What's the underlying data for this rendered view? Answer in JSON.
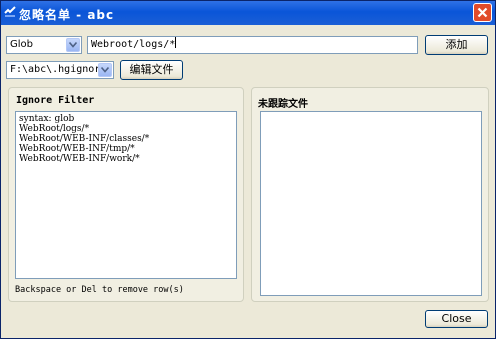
{
  "window": {
    "title": "忽略名单 - abc",
    "icons": {
      "app": "app-icon",
      "close": "close-icon"
    }
  },
  "toolbar": {
    "syntax_select": {
      "value": "Glob"
    },
    "pattern_input": {
      "value": "Webroot/logs/*"
    },
    "add_button": {
      "label": "添加"
    },
    "file_select": {
      "value": "F:\\abc\\.hgignore"
    },
    "edit_file_button": {
      "label": "编辑文件"
    }
  },
  "ignore_filter": {
    "title": "Ignore Filter",
    "rows": [
      "syntax: glob",
      "WebRoot/logs/*",
      "WebRoot/WEB-INF/classes/*",
      "WebRoot/WEB-INF/tmp/*",
      "WebRoot/WEB-INF/work/*"
    ],
    "hint": "Backspace or Del to remove row(s)"
  },
  "untracked": {
    "title": "未跟踪文件",
    "rows": []
  },
  "footer": {
    "close_button": {
      "label": "Close"
    }
  },
  "colors": {
    "titlebar": "#0a55d8",
    "dialog_bg": "#ece9d8",
    "close_red": "#e14b2a",
    "field_border": "#7f9db9"
  }
}
